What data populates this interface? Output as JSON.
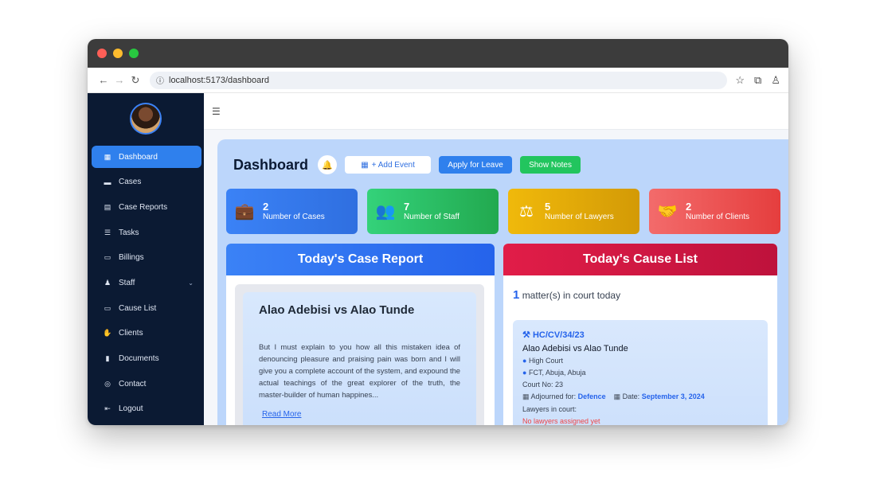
{
  "browser": {
    "url": "localhost:5173/dashboard",
    "traffic_colors": [
      "#ff5f57",
      "#febc2e",
      "#28c840"
    ]
  },
  "sidebar": {
    "items": [
      {
        "label": "Dashboard",
        "icon": "grid-icon",
        "glyph": "▦",
        "active": true
      },
      {
        "label": "Cases",
        "icon": "briefcase-icon",
        "glyph": "▬"
      },
      {
        "label": "Case Reports",
        "icon": "report-icon",
        "glyph": "▤"
      },
      {
        "label": "Tasks",
        "icon": "tasks-icon",
        "glyph": "☰"
      },
      {
        "label": "Billings",
        "icon": "money-icon",
        "glyph": "▭"
      },
      {
        "label": "Staff",
        "icon": "users-icon",
        "glyph": "♟",
        "chevron": "⌄"
      },
      {
        "label": "Cause List",
        "icon": "list-icon",
        "glyph": "▭"
      },
      {
        "label": "Clients",
        "icon": "handshake-icon",
        "glyph": "✋"
      },
      {
        "label": "Documents",
        "icon": "document-icon",
        "glyph": "▮"
      },
      {
        "label": "Contact",
        "icon": "contact-icon",
        "glyph": "◎"
      },
      {
        "label": "Logout",
        "icon": "logout-icon",
        "glyph": "⇤"
      }
    ]
  },
  "dashboard": {
    "title": "Dashboard",
    "add_event": "+ Add Event",
    "apply_leave": "Apply for Leave",
    "show_notes": "Show Notes"
  },
  "stats": [
    {
      "value": "2",
      "label": "Number of Cases",
      "icon": "briefcase-icon",
      "glyph": "💼",
      "color_from": "#3b82f6",
      "color_to": "#2f6fe0"
    },
    {
      "value": "7",
      "label": "Number of Staff",
      "icon": "users-icon",
      "glyph": "👥",
      "color_from": "#34d27a",
      "color_to": "#22a94f"
    },
    {
      "value": "5",
      "label": "Number of Lawyers",
      "icon": "scales-icon",
      "glyph": "⚖",
      "color_from": "#f0b90b",
      "color_to": "#d39a06"
    },
    {
      "value": "2",
      "label": "Number of Clients",
      "icon": "handshake-icon",
      "glyph": "🤝",
      "color_from": "#f36b6b",
      "color_to": "#e53e3e"
    }
  ],
  "case_report": {
    "heading": "Today's Case Report",
    "title": "Alao Adebisi vs Alao Tunde",
    "text": "But I must explain to you how all this mistaken idea of denouncing pleasure and praising pain was born and I will give you a complete account of the system, and expound the actual teachings of the great explorer of the truth, the master-builder of human happines...",
    "read_more": "Read More"
  },
  "cause_list": {
    "heading": "Today's Cause List",
    "count": "1",
    "count_suffix": "matter(s) in court today",
    "suit_no": "HC/CV/34/23",
    "case_title": "Alao Adebisi vs Alao Tunde",
    "court": "High Court",
    "location": "FCT, Abuja, Abuja",
    "court_no": "Court No: 23",
    "adjourned_label": "Adjourned for:",
    "adjourned_value": "Defence",
    "date_label": "Date:",
    "date_value": "September 3, 2024",
    "lawyers_label": "Lawyers in court:",
    "lawyers_value": "No lawyers assigned yet"
  }
}
